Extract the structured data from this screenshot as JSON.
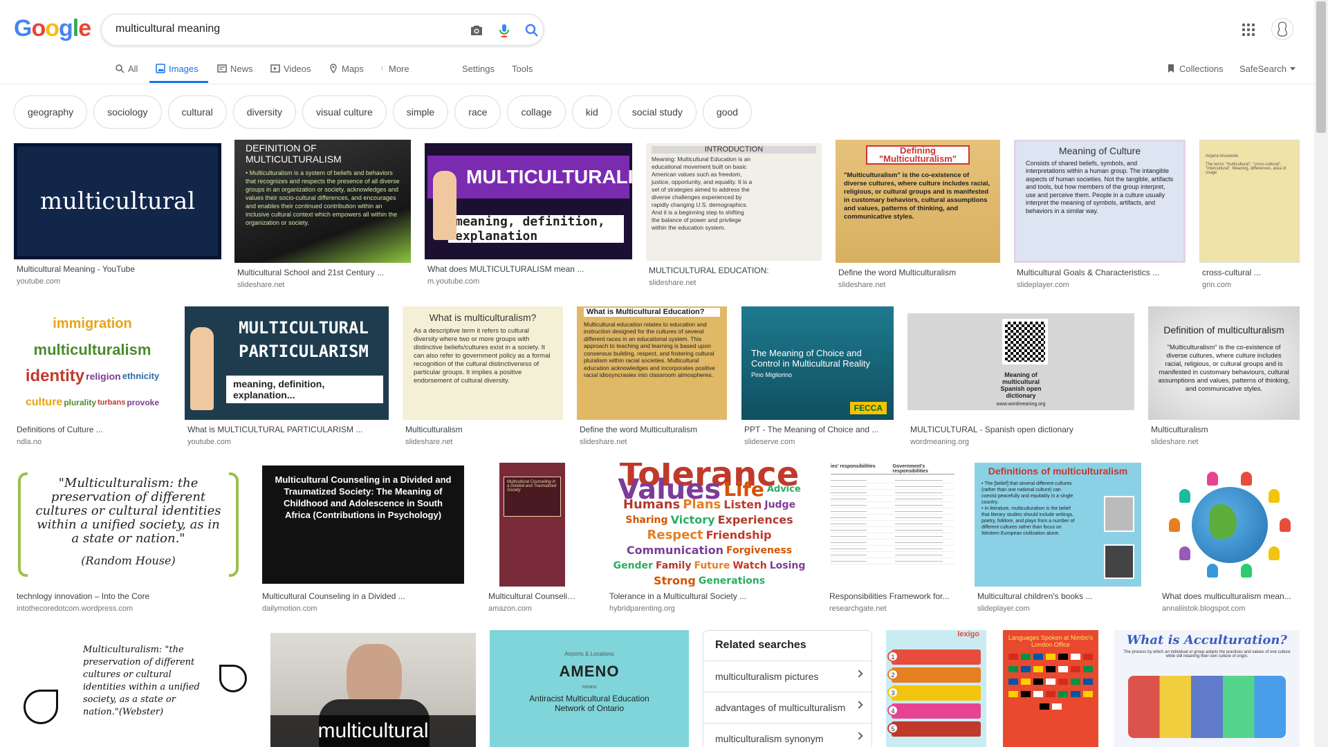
{
  "header": {
    "logo": "Google",
    "logo_colors": [
      "#4285f4",
      "#ea4335",
      "#fbbc05",
      "#4285f4",
      "#34a853",
      "#ea4335"
    ],
    "search_query": "multicultural meaning",
    "icons": [
      "camera-icon",
      "mic-icon",
      "search-icon",
      "apps-icon",
      "avatar"
    ]
  },
  "tabs": [
    {
      "label": "All",
      "icon": "search-icon"
    },
    {
      "label": "Images",
      "icon": "image-icon",
      "active": true
    },
    {
      "label": "News",
      "icon": "news-icon"
    },
    {
      "label": "Videos",
      "icon": "video-icon"
    },
    {
      "label": "Maps",
      "icon": "map-pin-icon"
    },
    {
      "label": "More",
      "icon": "kebab-icon"
    }
  ],
  "tools": {
    "settings": "Settings",
    "tools": "Tools",
    "collections": "Collections",
    "safesearch": "SafeSearch"
  },
  "chips": [
    "geography",
    "sociology",
    "cultural",
    "diversity",
    "visual culture",
    "simple",
    "race",
    "collage",
    "kid",
    "social study",
    "good"
  ],
  "results": [
    {
      "title": "Multicultural Meaning - YouTube",
      "source": "youtube.com",
      "text": "multicultural"
    },
    {
      "title": "Multicultural School and 21st Century ...",
      "source": "slideshare.net",
      "text": "DEFINITION OF MULTICULTURALISM",
      "body": "Multiculturalism is a system of beliefs and behaviors that recognizes and respects the presence of all diverse groups in an organization or society, acknowledges and values their socio-cultural differences, and encourages and enables their continued contribution within an inclusive cultural context which empowers all within the organization or society."
    },
    {
      "title": "What does MULTICULTURALISM mean ...",
      "source": "m.youtube.com",
      "text": "MULTICULTURALISM",
      "sub": "meaning, definition, explanation"
    },
    {
      "title": "MULTICULTURAL EDUCATION:",
      "source": "slideshare.net",
      "text": "INTRODUCTION",
      "body": "Meaning: Multicultural Education is an educational movement built on basic American values such as freedom, justice, opportunity, and equality. It is a set of strategies aimed to address the diverse challenges experienced by rapidly changing U.S. demographics. And it is a beginning step to shifting the balance of power and privilege within the education system."
    },
    {
      "title": "Define the word Multiculturalism",
      "source": "slideshare.net",
      "text": "Defining \"Multiculturalism\"",
      "body": "\"Multiculturalism\" is the co-existence of diverse cultures, where culture includes racial, religious, or cultural groups and is manifested in customary behaviors, cultural assumptions and values, patterns of thinking, and communicative styles."
    },
    {
      "title": "Multicultural Goals & Characteristics ...",
      "source": "slideplayer.com",
      "text": "Meaning of Culture",
      "body": "Consists of shared beliefs, symbols, and interpretations within a human group. The intangible aspects of human societies. Not the tangible, artifacts and tools, but how members of the group interpret, use and perceive them. People in a culture usually interpret the meaning of symbols, artifacts, and behaviors in a similar way."
    },
    {
      "title": "cross-cultural ...",
      "source": "grin.com"
    },
    {
      "title": "Definitions of Culture ...",
      "source": "ndla.no",
      "words": [
        "immigration",
        "multiculturalism",
        "identity",
        "religion",
        "ethnicity",
        "culture",
        "plurality",
        "turbans",
        "provoke"
      ]
    },
    {
      "title": "What is MULTICULTURAL PARTICULARISM ...",
      "source": "youtube.com",
      "text": "MULTICULTURAL PARTICULARISM",
      "sub": "meaning, definition, explanation..."
    },
    {
      "title": "Multiculturalism",
      "source": "slideshare.net",
      "text": "What is multiculturalism?",
      "body": "As a descriptive term it refers to cultural diversity where two or more groups with distinctive beliefs/cultures exist in a society. It can also refer to government policy as a formal recognition of the cultural distinctiveness of particular groups. It implies a positive endorsement of cultural diversity."
    },
    {
      "title": "Define the word Multiculturalism",
      "source": "slideshare.net",
      "text": "What is Multicultural Education?",
      "body": "Multicultural education relates to education and instruction designed for the cultures of several different races in an educational system. This approach to teaching and learning is based upon consensus building, respect, and fostering cultural pluralism within racial societies. Multicultural education acknowledges and incorporates positive racial idiosyncrasies into classroom atmospheres."
    },
    {
      "title": "PPT - The Meaning of Choice and ...",
      "source": "slideserve.com",
      "text": "The Meaning of Choice and Control in Multicultural Reality",
      "sub": "Pino Migliorino",
      "badge": "FECCA"
    },
    {
      "title": "MULTICULTURAL - Spanish open dictionary",
      "source": "wordmeaning.org",
      "text": "Meaning of multicultural Spanish open dictionary",
      "sub": "www.wordmeaning.org"
    },
    {
      "title": "Multiculturalism",
      "source": "slideshare.net",
      "text": "Definition of multiculturalism",
      "body": "\"Multiculturalism\" is the co-existence of diverse cultures, where culture includes racial, religious, or cultural groups and is manifested in customary behaviours, cultural assumptions and values, patterns of thinking, and communicative styles."
    },
    {
      "title": "technlogy innovation – Into the Core",
      "source": "intothecoredotcom.wordpress.com",
      "text": "\"Multiculturalism: the preservation of different cultures or cultural identities within a unified society, as in a state or nation.\"",
      "sub": "(Random House)"
    },
    {
      "title": "Multicultural Counseling in a Divided ...",
      "source": "dailymotion.com",
      "text": "Multicultural Counseling in a Divided and Traumatized Society: The Meaning of Childhood and Adolescence in South Africa (Contributions in Psychology)"
    },
    {
      "title": "Multicultural Counseling ...",
      "source": "amazon.com",
      "text": "Multicultural Counseling in a Divided and Traumatized Society"
    },
    {
      "title": "Tolerance in a Multicultural Society ...",
      "source": "hybridparenting.org",
      "words": [
        "Tolerance",
        "Values",
        "Life",
        "Advice",
        "Humans",
        "Plans",
        "Listen",
        "Judge",
        "Sharing",
        "Victory",
        "Experiences",
        "Respect",
        "Friendship",
        "Communication",
        "Forgiveness",
        "Gender",
        "Family",
        "Future",
        "Watch",
        "Losing",
        "Strong",
        "Generations"
      ]
    },
    {
      "title": "Responsibilities Framework for...",
      "source": "researchgate.net",
      "text": "Government's responsibilities"
    },
    {
      "title": "Multicultural children's books ...",
      "source": "slideplayer.com",
      "text": "Definitions of multiculturalism"
    },
    {
      "title": "What does multiculturalism mean...",
      "source": "annaliistok.blogspot.com"
    },
    {
      "title": "",
      "source": "",
      "text": "Multiculturalism: \"the preservation of different cultures or cultural identities within a unified society, as a state or nation.\"(Webster)"
    },
    {
      "title": "",
      "source": "",
      "text": "multicultural"
    },
    {
      "title": "",
      "source": "",
      "text": "AMENO",
      "sub": "Antiracist Multicultural Education Network of Ontario",
      "small": "Airports & Locations",
      "means": "means"
    },
    {
      "title": "",
      "source": "",
      "text": "lexigo"
    },
    {
      "title": "",
      "source": "",
      "text": "Languages Spoken at Nimbo's London Office"
    },
    {
      "title": "",
      "source": "",
      "text": "What is Acculturation?"
    }
  ],
  "related": {
    "heading": "Related searches",
    "items": [
      "multiculturalism pictures",
      "advantages of multiculturalism",
      "multiculturalism synonym"
    ]
  },
  "colors": {
    "accent": "#1a73e8",
    "chip_border": "#dadce0",
    "source_text": "#70757a"
  }
}
